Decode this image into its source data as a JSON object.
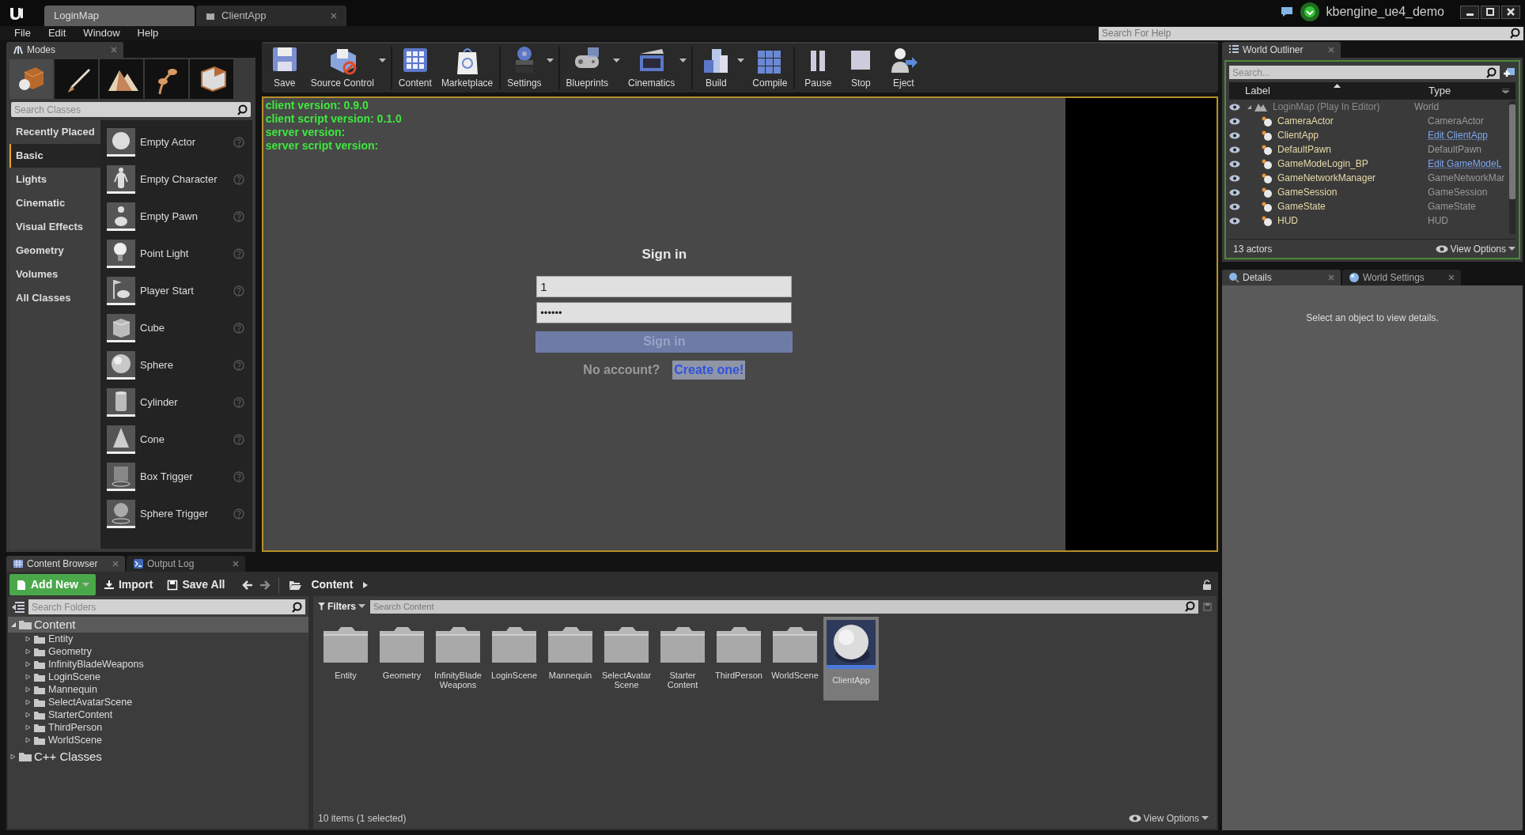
{
  "title_bar": {
    "tabs": [
      {
        "label": "LoginMap",
        "selected": true
      },
      {
        "label": "ClientApp",
        "selected": false
      }
    ],
    "project": "kbengine_ue4_demo"
  },
  "menu": [
    "File",
    "Edit",
    "Window",
    "Help"
  ],
  "help_search": {
    "placeholder": "Search For Help"
  },
  "modes": {
    "tab": "Modes",
    "mode_buttons": [
      {
        "selected": true
      },
      {
        "selected": false
      },
      {
        "selected": false
      },
      {
        "selected": false
      },
      {
        "selected": false
      }
    ],
    "search": {
      "placeholder": "Search Classes"
    },
    "categories": [
      {
        "label": "Recently Placed",
        "selected": false
      },
      {
        "label": "Basic",
        "selected": true
      },
      {
        "label": "Lights",
        "selected": false
      },
      {
        "label": "Cinematic",
        "selected": false
      },
      {
        "label": "Visual Effects",
        "selected": false
      },
      {
        "label": "Geometry",
        "selected": false
      },
      {
        "label": "Volumes",
        "selected": false
      },
      {
        "label": "All Classes",
        "selected": false
      }
    ],
    "items": [
      "Empty Actor",
      "Empty Character",
      "Empty Pawn",
      "Point Light",
      "Player Start",
      "Cube",
      "Sphere",
      "Cylinder",
      "Cone",
      "Box Trigger",
      "Sphere Trigger"
    ]
  },
  "toolbar": [
    {
      "label": "Save",
      "dropdown": false
    },
    {
      "label": "Source Control",
      "dropdown": true
    },
    {
      "label": "Content",
      "dropdown": false
    },
    {
      "label": "Marketplace",
      "dropdown": false
    },
    {
      "label": "Settings",
      "dropdown": true
    },
    {
      "label": "Blueprints",
      "dropdown": true
    },
    {
      "label": "Cinematics",
      "dropdown": true
    },
    {
      "label": "Build",
      "dropdown": true
    },
    {
      "label": "Compile",
      "dropdown": false
    },
    {
      "label": "Pause",
      "dropdown": false
    },
    {
      "label": "Stop",
      "dropdown": false
    },
    {
      "label": "Eject",
      "dropdown": false
    }
  ],
  "viewport": {
    "info": [
      "client version: 0.9.0",
      "client script version: 0.1.0",
      "server version:",
      "server script version:"
    ],
    "sign_in": {
      "title": "Sign in",
      "username": "1",
      "password": "••••••",
      "button": "Sign in",
      "prompt": "No account?",
      "link": "Create one!"
    }
  },
  "outliner": {
    "tab": "World Outliner",
    "search": {
      "placeholder": "Search..."
    },
    "columns": [
      "Label",
      "Type"
    ],
    "root": {
      "label": "LoginMap (Play In Editor)",
      "type": "World",
      "expanded": true,
      "children": [
        {
          "label": "CameraActor",
          "type": "CameraActor",
          "type_is_link": false
        },
        {
          "label": "ClientApp",
          "type": "Edit ClientApp",
          "type_is_link": true
        },
        {
          "label": "DefaultPawn",
          "type": "DefaultPawn",
          "type_is_link": false
        },
        {
          "label": "GameModeLogin_BP",
          "type": "Edit GameModeL",
          "type_is_link": true
        },
        {
          "label": "GameNetworkManager",
          "type": "GameNetworkMar",
          "type_is_link": false
        },
        {
          "label": "GameSession",
          "type": "GameSession",
          "type_is_link": false
        },
        {
          "label": "GameState",
          "type": "GameState",
          "type_is_link": false
        },
        {
          "label": "HUD",
          "type": "HUD",
          "type_is_link": false
        }
      ]
    },
    "count": "13 actors",
    "view_options": "View Options"
  },
  "details": {
    "tabs": [
      {
        "label": "Details",
        "selected": true
      },
      {
        "label": "World Settings",
        "selected": false
      }
    ],
    "message": "Select an object to view details."
  },
  "content_browser": {
    "tabs": [
      {
        "label": "Content Browser",
        "selected": true
      },
      {
        "label": "Output Log",
        "selected": false
      }
    ],
    "buttons": [
      "Add New",
      "Import",
      "Save All"
    ],
    "path": "Content",
    "folder_search": {
      "placeholder": "Search Folders"
    },
    "tree": [
      {
        "label": "Content",
        "expanded": true,
        "children": [
          {
            "label": "Entity"
          },
          {
            "label": "Geometry"
          },
          {
            "label": "InfinityBladeWeapons"
          },
          {
            "label": "LoginScene"
          },
          {
            "label": "Mannequin"
          },
          {
            "label": "SelectAvatarScene"
          },
          {
            "label": "StarterContent"
          },
          {
            "label": "ThirdPerson"
          },
          {
            "label": "WorldScene"
          }
        ]
      },
      {
        "label": "C++ Classes",
        "expanded": false
      }
    ],
    "filters": "Filters",
    "content_search": {
      "placeholder": "Search Content"
    },
    "assets": [
      {
        "label": "Entity",
        "kind": "folder",
        "selected": false
      },
      {
        "label": "Geometry",
        "kind": "folder",
        "selected": false
      },
      {
        "label": "InfinityBlade Weapons",
        "kind": "folder",
        "selected": false
      },
      {
        "label": "LoginScene",
        "kind": "folder",
        "selected": false
      },
      {
        "label": "Mannequin",
        "kind": "folder",
        "selected": false
      },
      {
        "label": "SelectAvatar Scene",
        "kind": "folder",
        "selected": false
      },
      {
        "label": "Starter Content",
        "kind": "folder",
        "selected": false
      },
      {
        "label": "ThirdPerson",
        "kind": "folder",
        "selected": false
      },
      {
        "label": "WorldScene",
        "kind": "folder",
        "selected": false
      },
      {
        "label": "ClientApp",
        "kind": "blueprint",
        "selected": true
      }
    ],
    "status": "10 items (1 selected)",
    "view_options": "View Options"
  }
}
